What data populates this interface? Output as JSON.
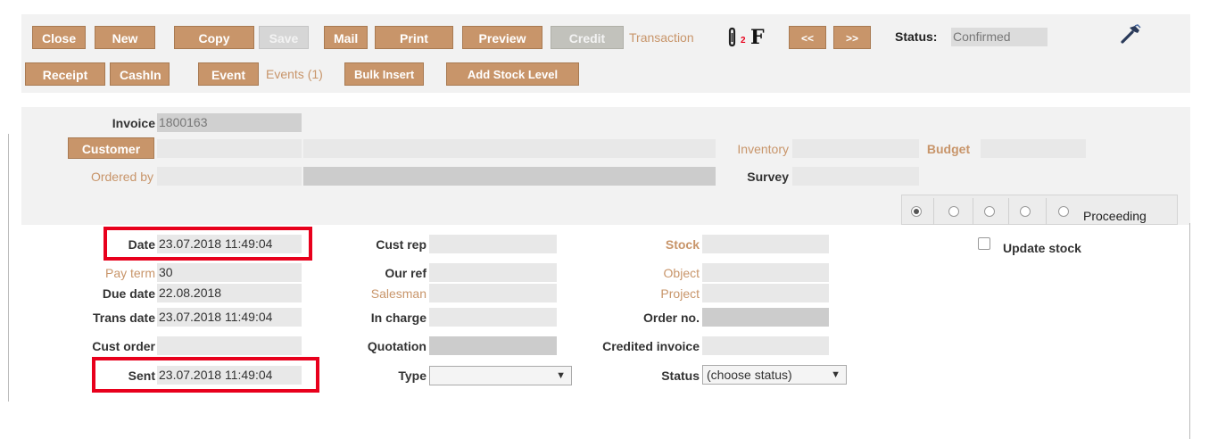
{
  "toolbar": {
    "row1": [
      "Close",
      "New",
      "Copy",
      "Save",
      "Mail",
      "Print",
      "Preview",
      "Credit"
    ],
    "transaction": "Transaction",
    "attachment_count": "2",
    "f_label": "F",
    "prev": "<<",
    "next": ">>",
    "status_label": "Status:",
    "status_value": "Confirmed",
    "row2": [
      "Receipt",
      "CashIn",
      "Event"
    ],
    "events": "Events (1)",
    "bulk_insert": "Bulk Insert",
    "add_stock_level": "Add Stock Level"
  },
  "header": {
    "invoice_label": "Invoice",
    "invoice_value": "1800163",
    "customer_button": "Customer",
    "ordered_by_label": "Ordered by",
    "inventory_label": "Inventory",
    "budget_label": "Budget",
    "survey_label": "Survey"
  },
  "tabs": {
    "proceeding_label": "Proceeding"
  },
  "form": {
    "date_label": "Date",
    "date_value": "23.07.2018 11:49:04",
    "pay_term_label": "Pay term",
    "pay_term_value": "30",
    "due_date_label": "Due date",
    "due_date_value": "22.08.2018",
    "trans_date_label": "Trans date",
    "trans_date_value": "23.07.2018 11:49:04",
    "cust_order_label": "Cust order",
    "sent_label": "Sent",
    "sent_value": "23.07.2018 11:49:04",
    "cust_rep_label": "Cust rep",
    "our_ref_label": "Our ref",
    "salesman_label": "Salesman",
    "in_charge_label": "In charge",
    "quotation_label": "Quotation",
    "type_label": "Type",
    "stock_label": "Stock",
    "object_label": "Object",
    "project_label": "Project",
    "order_no_label": "Order no.",
    "credited_invoice_label": "Credited invoice",
    "status_label": "Status",
    "status_select": "(choose status)",
    "update_stock_label": "Update stock"
  }
}
